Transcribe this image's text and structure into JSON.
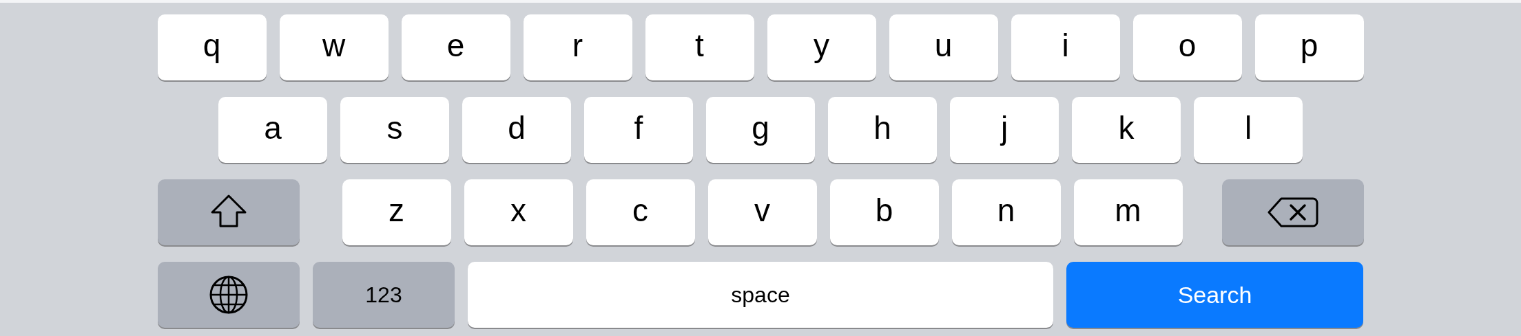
{
  "keyboard": {
    "rows": [
      {
        "keys": [
          {
            "kind": "letter",
            "label": "q"
          },
          {
            "kind": "letter",
            "label": "w"
          },
          {
            "kind": "letter",
            "label": "e"
          },
          {
            "kind": "letter",
            "label": "r"
          },
          {
            "kind": "letter",
            "label": "t"
          },
          {
            "kind": "letter",
            "label": "y"
          },
          {
            "kind": "letter",
            "label": "u"
          },
          {
            "kind": "letter",
            "label": "i"
          },
          {
            "kind": "letter",
            "label": "o"
          },
          {
            "kind": "letter",
            "label": "p"
          }
        ]
      },
      {
        "keys": [
          {
            "kind": "letter",
            "label": "a"
          },
          {
            "kind": "letter",
            "label": "s"
          },
          {
            "kind": "letter",
            "label": "d"
          },
          {
            "kind": "letter",
            "label": "f"
          },
          {
            "kind": "letter",
            "label": "g"
          },
          {
            "kind": "letter",
            "label": "h"
          },
          {
            "kind": "letter",
            "label": "j"
          },
          {
            "kind": "letter",
            "label": "k"
          },
          {
            "kind": "letter",
            "label": "l"
          }
        ]
      },
      {
        "keys": [
          {
            "kind": "shift"
          },
          {
            "kind": "letter",
            "label": "z"
          },
          {
            "kind": "letter",
            "label": "x"
          },
          {
            "kind": "letter",
            "label": "c"
          },
          {
            "kind": "letter",
            "label": "v"
          },
          {
            "kind": "letter",
            "label": "b"
          },
          {
            "kind": "letter",
            "label": "n"
          },
          {
            "kind": "letter",
            "label": "m"
          },
          {
            "kind": "delete"
          }
        ]
      },
      {
        "keys": [
          {
            "kind": "globe"
          },
          {
            "kind": "numbers",
            "label": "123"
          },
          {
            "kind": "space",
            "label": "space"
          },
          {
            "kind": "action",
            "label": "Search"
          }
        ]
      }
    ]
  }
}
